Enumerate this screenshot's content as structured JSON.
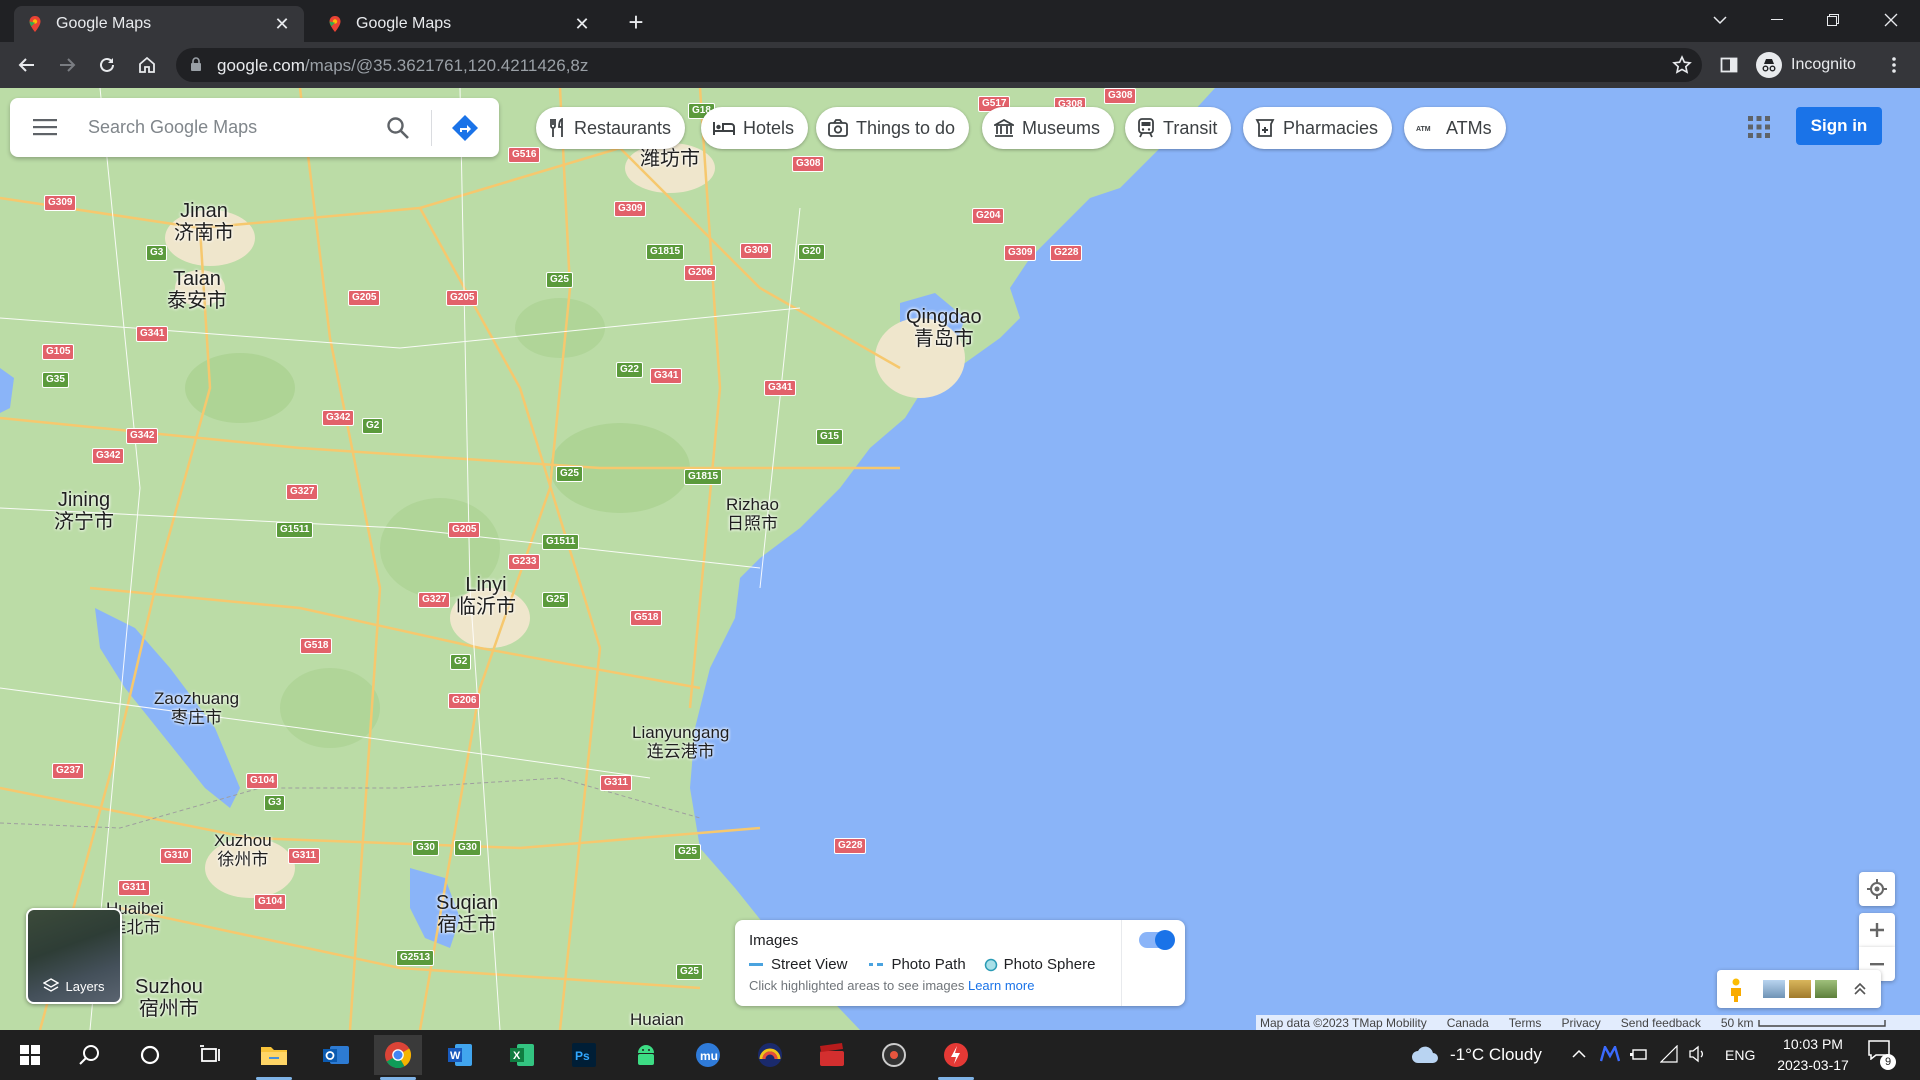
{
  "browser": {
    "tabs": [
      {
        "title": "Google Maps",
        "active": true
      },
      {
        "title": "Google Maps",
        "active": false
      }
    ],
    "url_host": "google.com",
    "url_path": "/maps/@35.3621761,120.4211426,8z",
    "profile_label": "Incognito"
  },
  "search": {
    "placeholder": "Search Google Maps"
  },
  "chips": [
    {
      "label": "Restaurants",
      "icon": "fork-knife-icon"
    },
    {
      "label": "Hotels",
      "icon": "bed-icon"
    },
    {
      "label": "Things to do",
      "icon": "camera-icon"
    },
    {
      "label": "Museums",
      "icon": "museum-icon"
    },
    {
      "label": "Transit",
      "icon": "train-icon"
    },
    {
      "label": "Pharmacies",
      "icon": "pharmacy-icon"
    },
    {
      "label": "ATMs",
      "icon": "atm-icon"
    }
  ],
  "signin_label": "Sign in",
  "map": {
    "cities": [
      {
        "en": "Jinan",
        "zh": "济南市"
      },
      {
        "en": "Taian",
        "zh": "泰安市"
      },
      {
        "en": "Jining",
        "zh": "济宁市"
      },
      {
        "en": "Linyi",
        "zh": "临沂市"
      },
      {
        "en": "Zaozhuang",
        "zh": "枣庄市"
      },
      {
        "en": "Xuzhou",
        "zh": "徐州市"
      },
      {
        "en": "Suqian",
        "zh": "宿迁市"
      },
      {
        "en": "Suzhou",
        "zh": "宿州市"
      },
      {
        "en": "Huaibei",
        "zh": "淮北市"
      },
      {
        "en": "Qingdao",
        "zh": "青岛市"
      },
      {
        "en": "Rizhao",
        "zh": "日照市"
      },
      {
        "en": "Lianyungang",
        "zh": "连云港市"
      },
      {
        "en": "",
        "zh": "潍坊市"
      },
      {
        "en": "Huaian",
        "zh": ""
      }
    ],
    "shields": [
      "G309",
      "G3",
      "G341",
      "G105",
      "G35",
      "G342",
      "G342",
      "G327",
      "G1511",
      "G205",
      "G342",
      "G2",
      "G25",
      "G22",
      "G341",
      "G341",
      "G15",
      "G1815",
      "G25",
      "G205",
      "G1511",
      "G233",
      "G25",
      "G327",
      "G518",
      "G518",
      "G2",
      "G206",
      "G237",
      "G104",
      "G3",
      "G310",
      "G311",
      "G311",
      "G104",
      "G30",
      "G30",
      "G2513",
      "G311",
      "G25",
      "G228",
      "G25",
      "G516",
      "G18",
      "G517",
      "G308",
      "G308",
      "G308",
      "G309",
      "G1815",
      "G206",
      "G309",
      "G20",
      "G204",
      "G309",
      "G228",
      "G205"
    ]
  },
  "layers_label": "Layers",
  "images_panel": {
    "title": "Images",
    "street_view": "Street View",
    "photo_path": "Photo Path",
    "photo_sphere": "Photo Sphere",
    "hint": "Click highlighted areas to see images",
    "learn_more": "Learn more"
  },
  "footer": {
    "map_data": "Map data ©2023 TMap Mobility",
    "country": "Canada",
    "terms": "Terms",
    "privacy": "Privacy",
    "feedback": "Send feedback",
    "scale": "50 km"
  },
  "taskbar": {
    "weather": "-1°C  Cloudy",
    "lang": "ENG",
    "time": "10:03 PM",
    "date": "2023-03-17",
    "notifications": "9"
  },
  "colors": {
    "water": "#8ab4f8",
    "land": "#bbdca6",
    "accent": "#1a73e8",
    "highway_red": "#e2616a",
    "highway_green": "#5b9a3c"
  }
}
